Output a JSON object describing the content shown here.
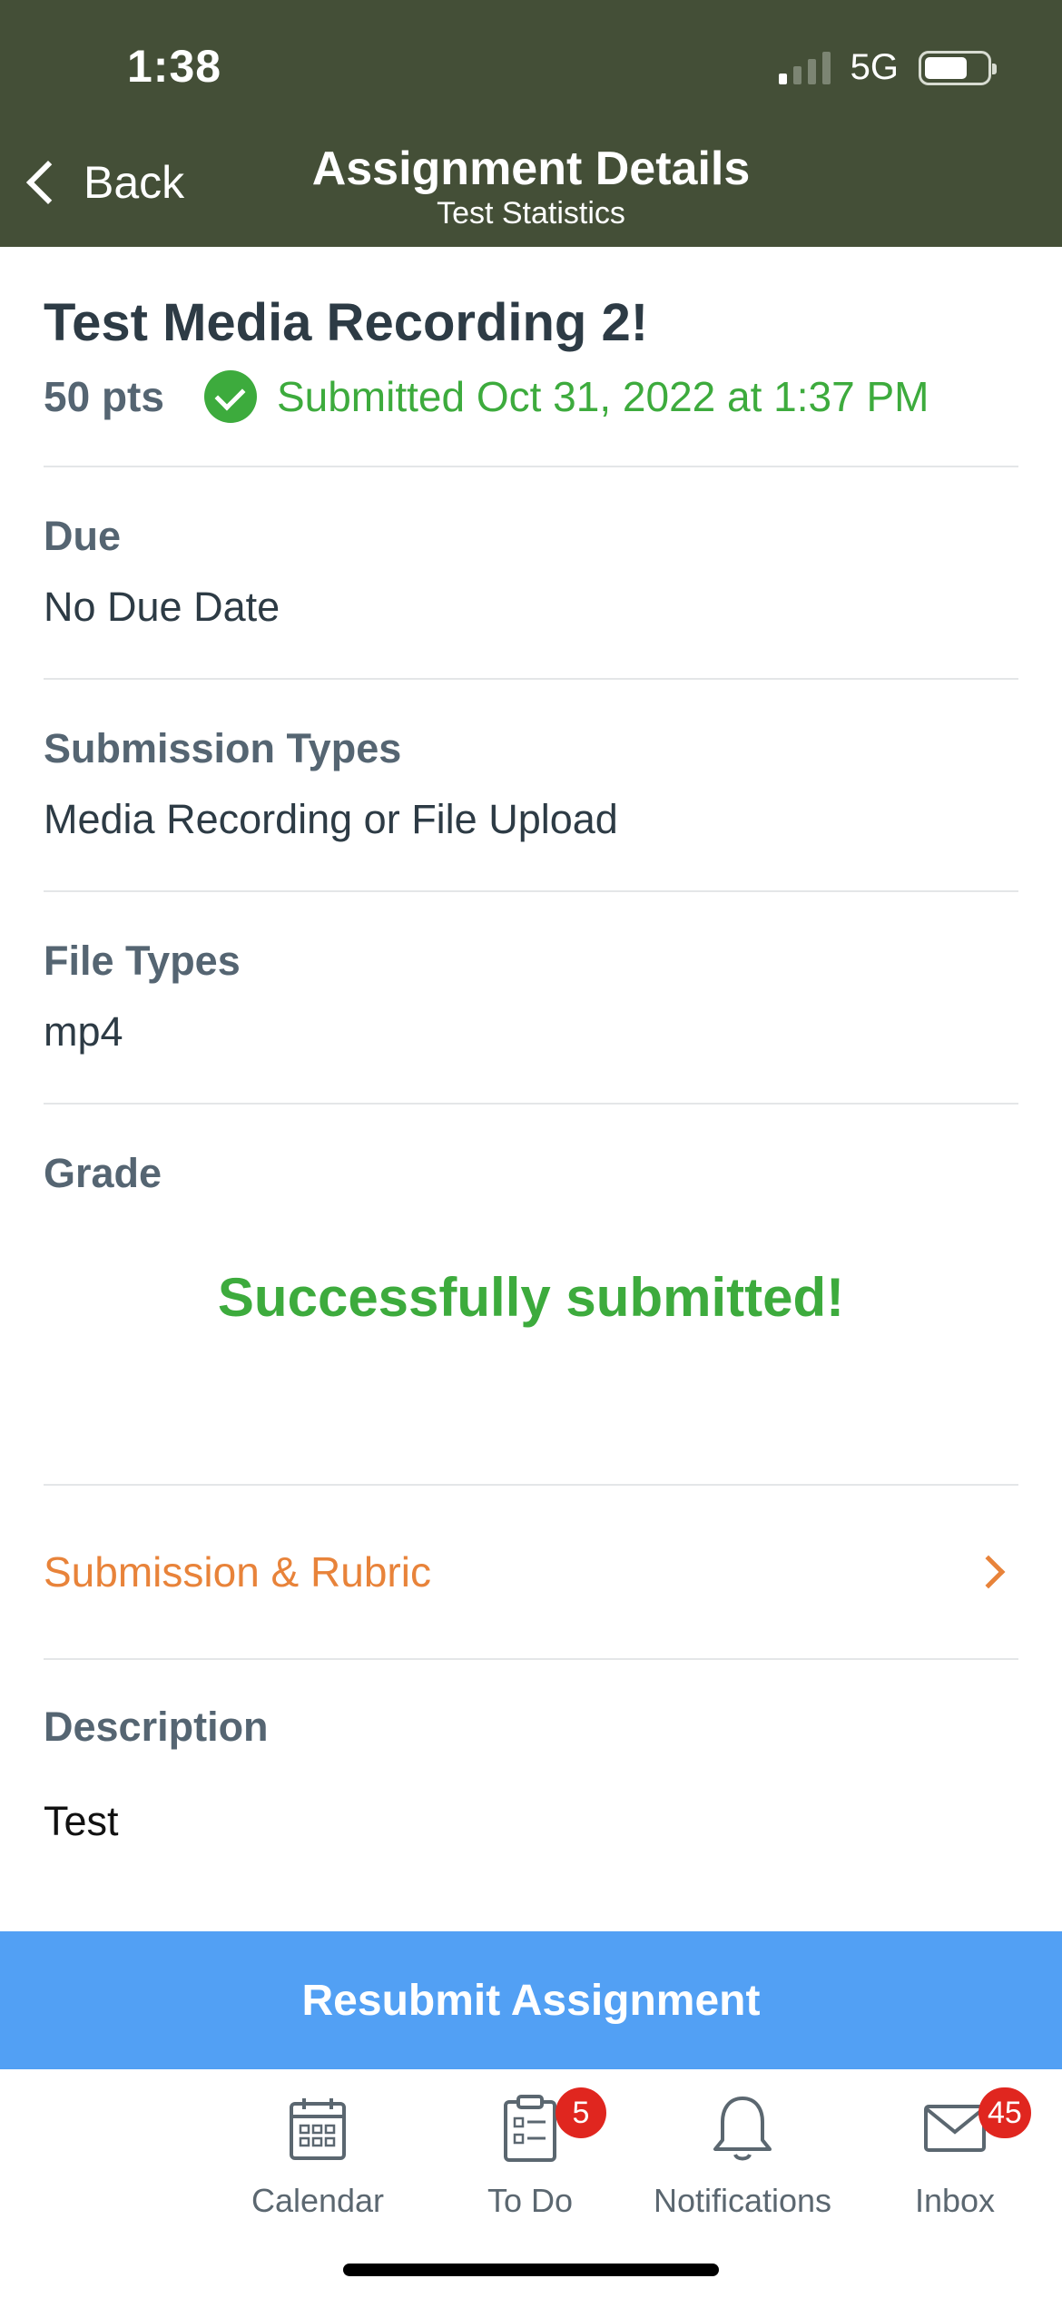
{
  "status_bar": {
    "time": "1:38",
    "network": "5G"
  },
  "nav": {
    "back_label": "Back",
    "title": "Assignment Details",
    "subtitle": "Test Statistics"
  },
  "assignment": {
    "title": "Test Media Recording 2!",
    "points": "50 pts",
    "submitted_text": "Submitted Oct 31, 2022 at 1:37 PM"
  },
  "sections": {
    "due": {
      "label": "Due",
      "value": "No Due Date"
    },
    "submission_types": {
      "label": "Submission Types",
      "value": "Media Recording or File Upload"
    },
    "file_types": {
      "label": "File Types",
      "value": "mp4"
    },
    "grade": {
      "label": "Grade",
      "message": "Successfully submitted!"
    },
    "submission_rubric": {
      "label": "Submission & Rubric"
    },
    "description": {
      "label": "Description",
      "value": "Test"
    }
  },
  "resubmit_label": "Resubmit Assignment",
  "tabbar": {
    "calendar": {
      "label": "Calendar"
    },
    "todo": {
      "label": "To Do",
      "badge": "5"
    },
    "notifications": {
      "label": "Notifications"
    },
    "inbox": {
      "label": "Inbox",
      "badge": "45"
    }
  },
  "colors": {
    "header": "#444f37",
    "success": "#3dab3d",
    "accent": "#e8833a",
    "button": "#52a0f4",
    "badge": "#e0261f"
  }
}
